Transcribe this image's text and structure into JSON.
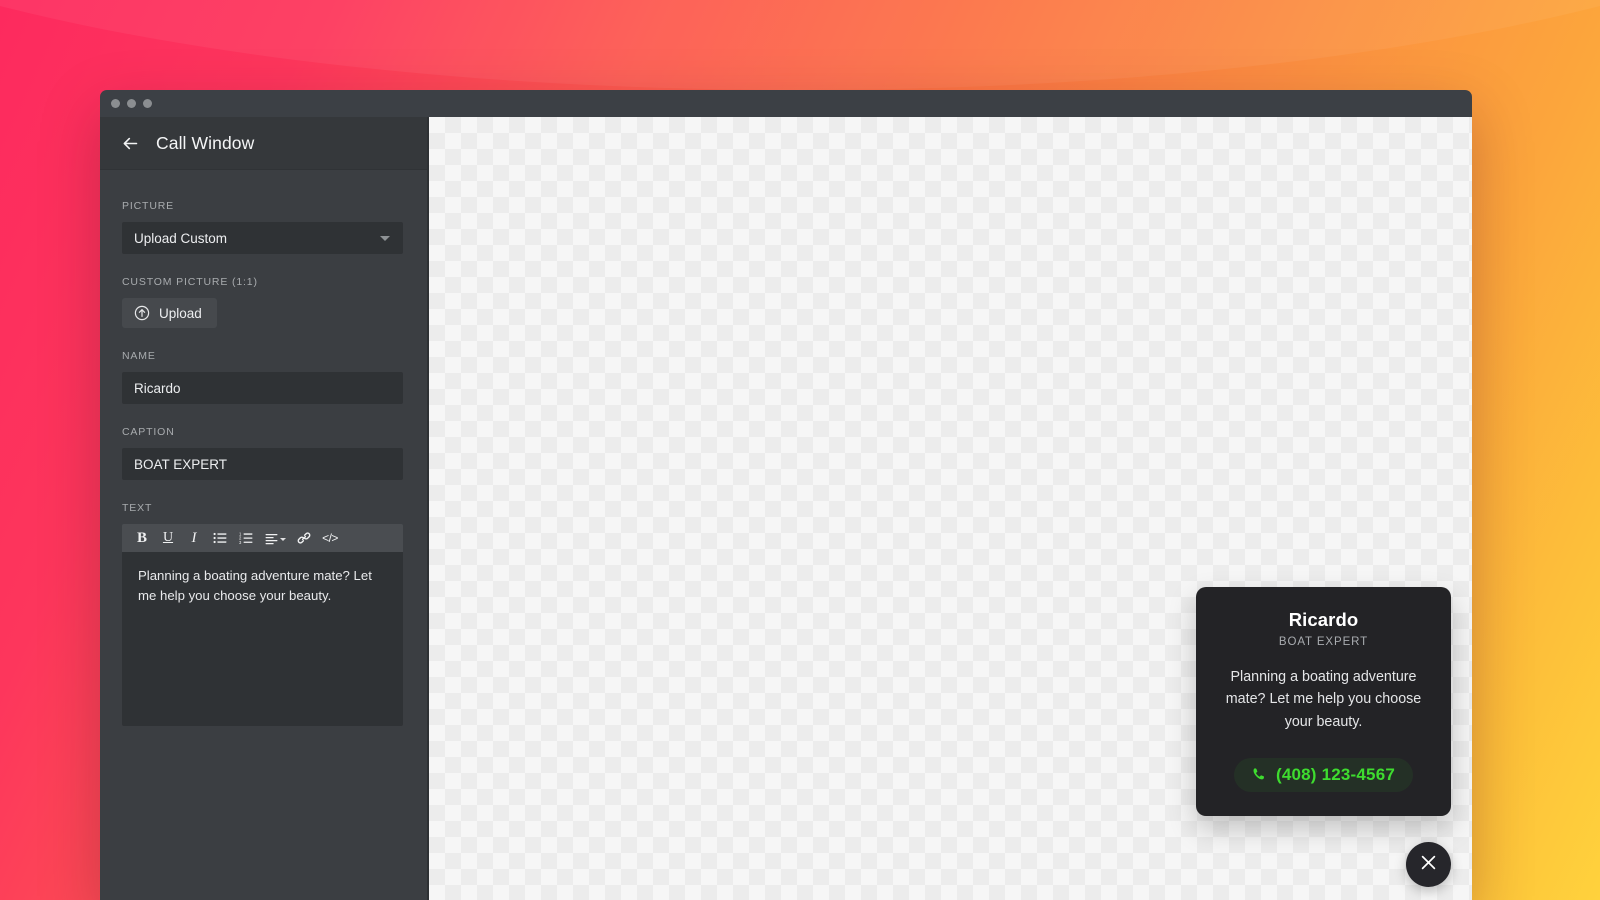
{
  "window": {
    "traffic_lights": [
      "close",
      "minimize",
      "maximize"
    ]
  },
  "sidebar": {
    "back_icon": "arrow-left-icon",
    "title": "Call Window",
    "fields": {
      "picture": {
        "label": "PICTURE",
        "selected": "Upload Custom",
        "caret_icon": "chevron-down-icon"
      },
      "custom_picture": {
        "label": "CUSTOM PICTURE (1:1)",
        "upload_label": "Upload",
        "upload_icon": "upload-circle-icon"
      },
      "name": {
        "label": "NAME",
        "value": "Ricardo"
      },
      "caption": {
        "label": "CAPTION",
        "value": "BOAT EXPERT"
      },
      "text": {
        "label": "TEXT",
        "value": "Planning a boating adventure mate? Let me help you choose your beauty.",
        "toolbar": [
          {
            "name": "bold",
            "glyph": "B"
          },
          {
            "name": "underline",
            "glyph": "U"
          },
          {
            "name": "italic",
            "glyph": "I"
          },
          {
            "name": "bulleted-list",
            "glyph": "list-ul-icon"
          },
          {
            "name": "numbered-list",
            "glyph": "list-ol-icon"
          },
          {
            "name": "align",
            "glyph": "align-left-icon"
          },
          {
            "name": "link",
            "glyph": "link-icon"
          },
          {
            "name": "source-code",
            "glyph": "</>"
          }
        ]
      }
    }
  },
  "canvas": {
    "call_card": {
      "name": "Ricardo",
      "caption": "BOAT EXPERT",
      "text": "Planning a boating adventure mate? Let me help you choose your beauty.",
      "phone": "(408) 123-4567",
      "phone_icon": "phone-icon",
      "phone_color": "#3edc2f"
    },
    "close_button": {
      "icon": "close-icon"
    }
  },
  "colors": {
    "sidebar_bg": "#3b3e42",
    "header_bg": "#35383b",
    "input_bg": "#2f3235",
    "card_bg": "#232326",
    "accent_green": "#3edc2f",
    "gradient_start": "#fd2a5e",
    "gradient_end": "#ffd23c"
  }
}
